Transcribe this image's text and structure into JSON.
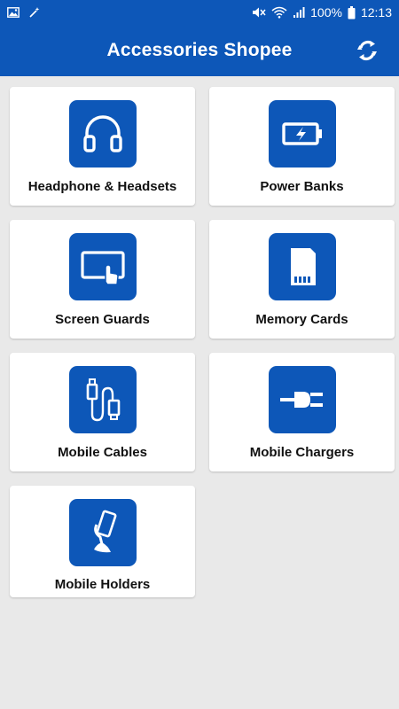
{
  "status_bar": {
    "battery": "100%",
    "time": "12:13",
    "icons": [
      "image-icon",
      "magic-wand-icon",
      "mute-icon",
      "wifi-icon",
      "signal-icon",
      "battery-icon"
    ]
  },
  "app_bar": {
    "title": "Accessories Shopee",
    "action_icon": "refresh-icon"
  },
  "categories": [
    {
      "label": "Headphone & Headsets",
      "icon": "headphones-icon"
    },
    {
      "label": "Power Banks",
      "icon": "battery-charging-icon"
    },
    {
      "label": "Screen Guards",
      "icon": "touch-screen-icon"
    },
    {
      "label": "Memory Cards",
      "icon": "memory-card-icon"
    },
    {
      "label": "Mobile Cables",
      "icon": "cable-icon"
    },
    {
      "label": "Mobile Chargers",
      "icon": "plug-icon"
    },
    {
      "label": "Mobile Holders",
      "icon": "phone-holder-icon"
    }
  ],
  "colors": {
    "primary": "#0d57b8",
    "background": "#e9e9e9",
    "card": "#ffffff",
    "text": "#111111"
  }
}
